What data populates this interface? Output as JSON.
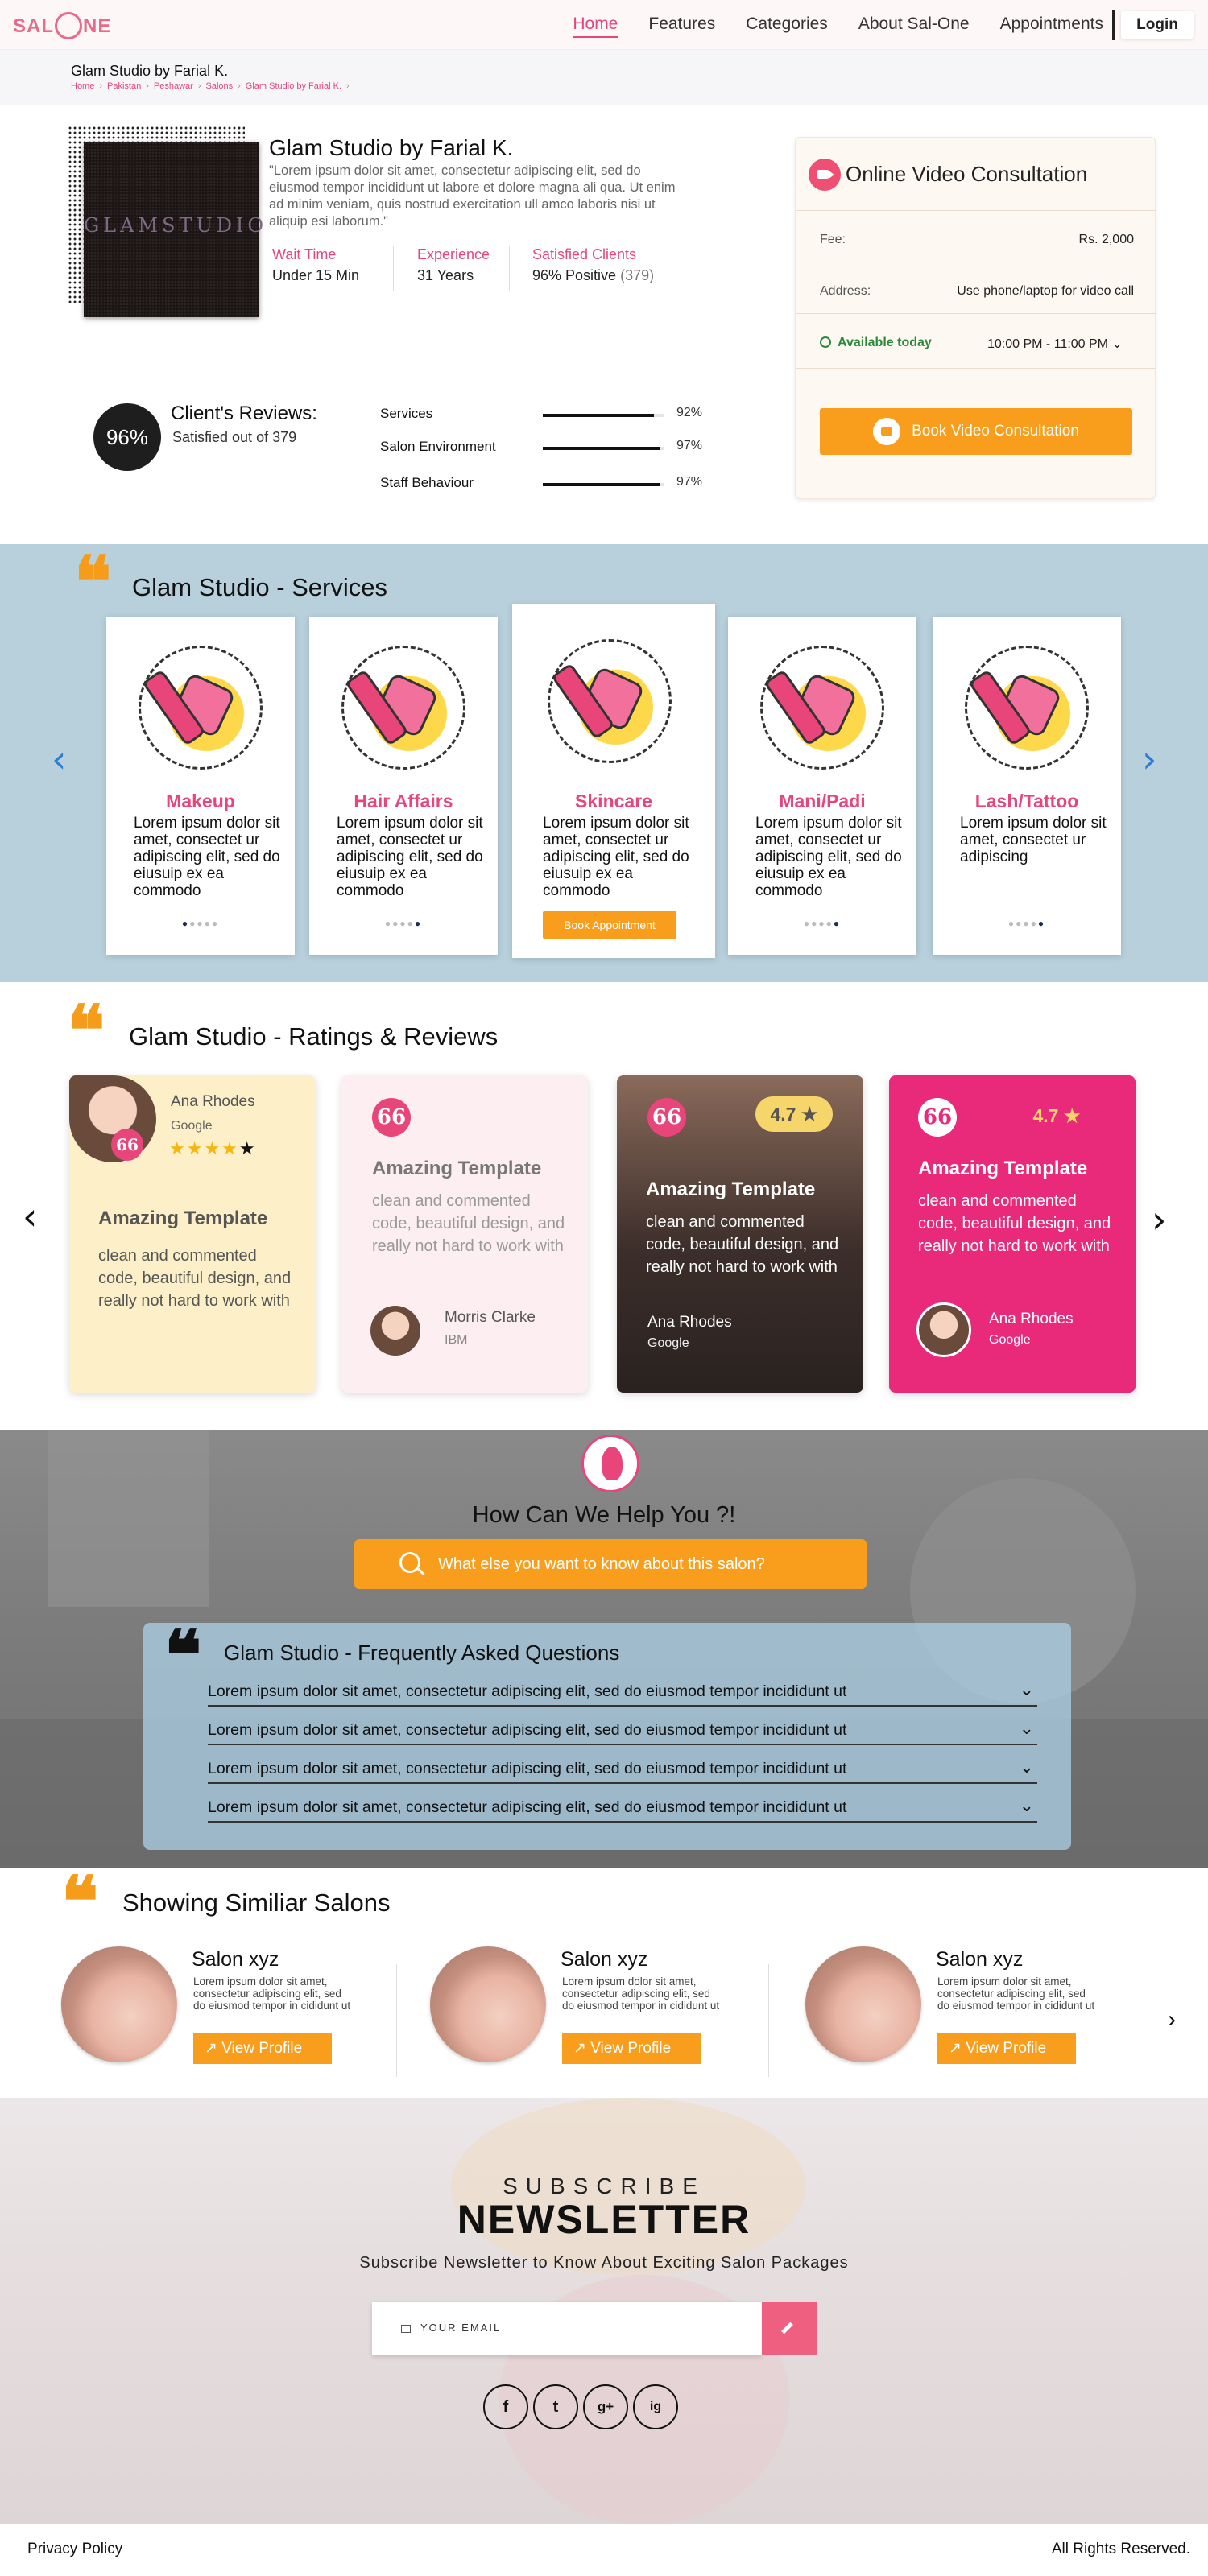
{
  "header": {
    "logo_text": "SAL ONE",
    "nav": [
      "Home",
      "Features",
      "Categories",
      "About Sal-One",
      "Appointments"
    ],
    "login_label": "Login"
  },
  "breadcrumb": {
    "title": "Glam Studio by Farial K.",
    "items": [
      "Home",
      "Pakistan",
      "Peshawar",
      "Salons",
      "Glam Studio by Farial K."
    ]
  },
  "profile": {
    "image_text": "GLAMSTUDIO",
    "name": "Glam Studio by Farial K.",
    "description": "\"Lorem ipsum dolor sit amet, consectetur adipiscing elit, sed do eiusmod tempor incididunt ut labore et dolore magna ali qua. Ut enim ad minim veniam, quis nostrud exercitation ull amco laboris nisi ut aliquip esi laborum.\"",
    "stats": [
      {
        "label": "Wait Time",
        "value": "Under 15 Min",
        "extra": ""
      },
      {
        "label": "Experience",
        "value": "31 Years",
        "extra": ""
      },
      {
        "label": "Satisfied Clients",
        "value": "96% Positive",
        "extra": "(379)"
      }
    ]
  },
  "reviews_summary": {
    "percent": "96%",
    "title": "Client's Reviews:",
    "subtitle": "Satisfied out of 379",
    "bars": [
      {
        "label": "Services",
        "value": 92,
        "text": "92%"
      },
      {
        "label": "Salon Environment",
        "value": 97,
        "text": "97%"
      },
      {
        "label": "Staff Behaviour",
        "value": 97,
        "text": "97%"
      }
    ]
  },
  "consultation": {
    "title": "Online Video Consultation",
    "fee_label": "Fee:",
    "fee_value": "Rs. 2,000",
    "address_label": "Address:",
    "address_value": "Use phone/laptop for video call",
    "availability": "Available today",
    "time": "10:00 PM - 11:00 PM ⌄",
    "button": "Book Video Consultation"
  },
  "services": {
    "title": "Glam Studio - Services",
    "items": [
      {
        "name": "Makeup",
        "desc": "Lorem ipsum dolor sit amet, consectet ur adipiscing elit, sed do eiusuip ex ea commodo",
        "dots": [
          "●",
          "●●●●"
        ]
      },
      {
        "name": "Hair Affairs",
        "desc": "Lorem ipsum dolor sit amet, consectet ur adipiscing elit, sed do eiusuip ex ea commodo",
        "dots": [
          "●",
          "●●●●"
        ]
      },
      {
        "name": "Skincare",
        "desc": "Lorem ipsum dolor sit amet, consectet ur adipiscing elit, sed do eiusuip ex ea commodo",
        "dots": [
          "",
          ""
        ]
      },
      {
        "name": "Mani/Padi",
        "desc": "Lorem ipsum dolor sit amet, consectet ur adipiscing elit, sed do eiusuip ex ea commodo",
        "dots": [
          "●",
          "●●●●"
        ]
      },
      {
        "name": "Lash/Tattoo",
        "desc": "Lorem ipsum dolor sit amet, consectet ur adipiscing",
        "dots": [
          "●",
          "●●●●"
        ]
      }
    ],
    "appointment_button": "Book Appointment"
  },
  "ratings": {
    "title": "Glam Studio - Ratings & Reviews",
    "cards": [
      {
        "reviewer": "Ana Rhodes",
        "company": "Google",
        "stars": "★★★★",
        "star_empty": "★",
        "title": "Amazing Template",
        "text": "clean and commented code, beautiful design, and really not hard to work with"
      },
      {
        "reviewer": "Morris Clarke",
        "company": "IBM",
        "title": "Amazing Template",
        "text": "clean and commented code, beautiful design, and really not hard to work with"
      },
      {
        "reviewer": "Ana Rhodes",
        "company": "Google",
        "rating": "4.7 ★",
        "title": "Amazing Template",
        "text": "clean and commented code, beautiful design, and really not hard to work with"
      },
      {
        "reviewer": "Ana Rhodes",
        "company": "Google",
        "rating": "4.7 ★",
        "title": "Amazing Template",
        "text": "clean and commented code, beautiful design, and really not hard to work with"
      }
    ]
  },
  "help": {
    "title": "How Can We Help You ?!",
    "search_placeholder": "What else you want to know about this salon?"
  },
  "faq": {
    "title": "Glam Studio - Frequently Asked Questions",
    "items": [
      "Lorem ipsum dolor sit amet, consectetur adipiscing elit, sed do eiusmod tempor incididunt ut",
      "Lorem ipsum dolor sit amet, consectetur adipiscing elit, sed do eiusmod tempor incididunt ut",
      "Lorem ipsum dolor sit amet, consectetur adipiscing elit, sed do eiusmod tempor incididunt ut",
      "Lorem ipsum dolor sit amet, consectetur adipiscing elit, sed do eiusmod tempor incididunt ut"
    ]
  },
  "similar": {
    "title": "Showing Similiar Salons",
    "items": [
      {
        "name": "Salon xyz",
        "desc": "Lorem ipsum dolor sit amet, consectetur adipiscing elit, sed do eiusmod tempor in cididunt ut",
        "button": "↗ View Profile"
      },
      {
        "name": "Salon xyz",
        "desc": "Lorem ipsum dolor sit amet, consectetur adipiscing elit, sed do eiusmod tempor in cididunt ut",
        "button": "↗ View Profile"
      },
      {
        "name": "Salon xyz",
        "desc": "Lorem ipsum dolor sit amet, consectetur adipiscing elit, sed do eiusmod tempor in cididunt ut",
        "button": "↗ View Profile"
      }
    ]
  },
  "newsletter": {
    "kicker": "SUBSCRIBE",
    "title": "NEWSLETTER",
    "subtitle": "Subscribe Newsletter to Know About Exciting Salon Packages",
    "email_placeholder": "YOUR EMAIL",
    "social": [
      "f",
      "t",
      "g+",
      "ig"
    ]
  },
  "footer": {
    "left": "Privacy Policy",
    "right": "All Rights Reserved."
  },
  "icons": {
    "quote": "❝",
    "arrow_left": "‹",
    "arrow_right": "›"
  },
  "colors": {
    "accent_pink": "#e8457a",
    "accent_orange": "#f99e1c",
    "services_bg": "#b7d0dc",
    "review_card_1": "#fdf0c8",
    "review_card_2": "#fdeef2",
    "review_card_4": "#e9297a"
  }
}
